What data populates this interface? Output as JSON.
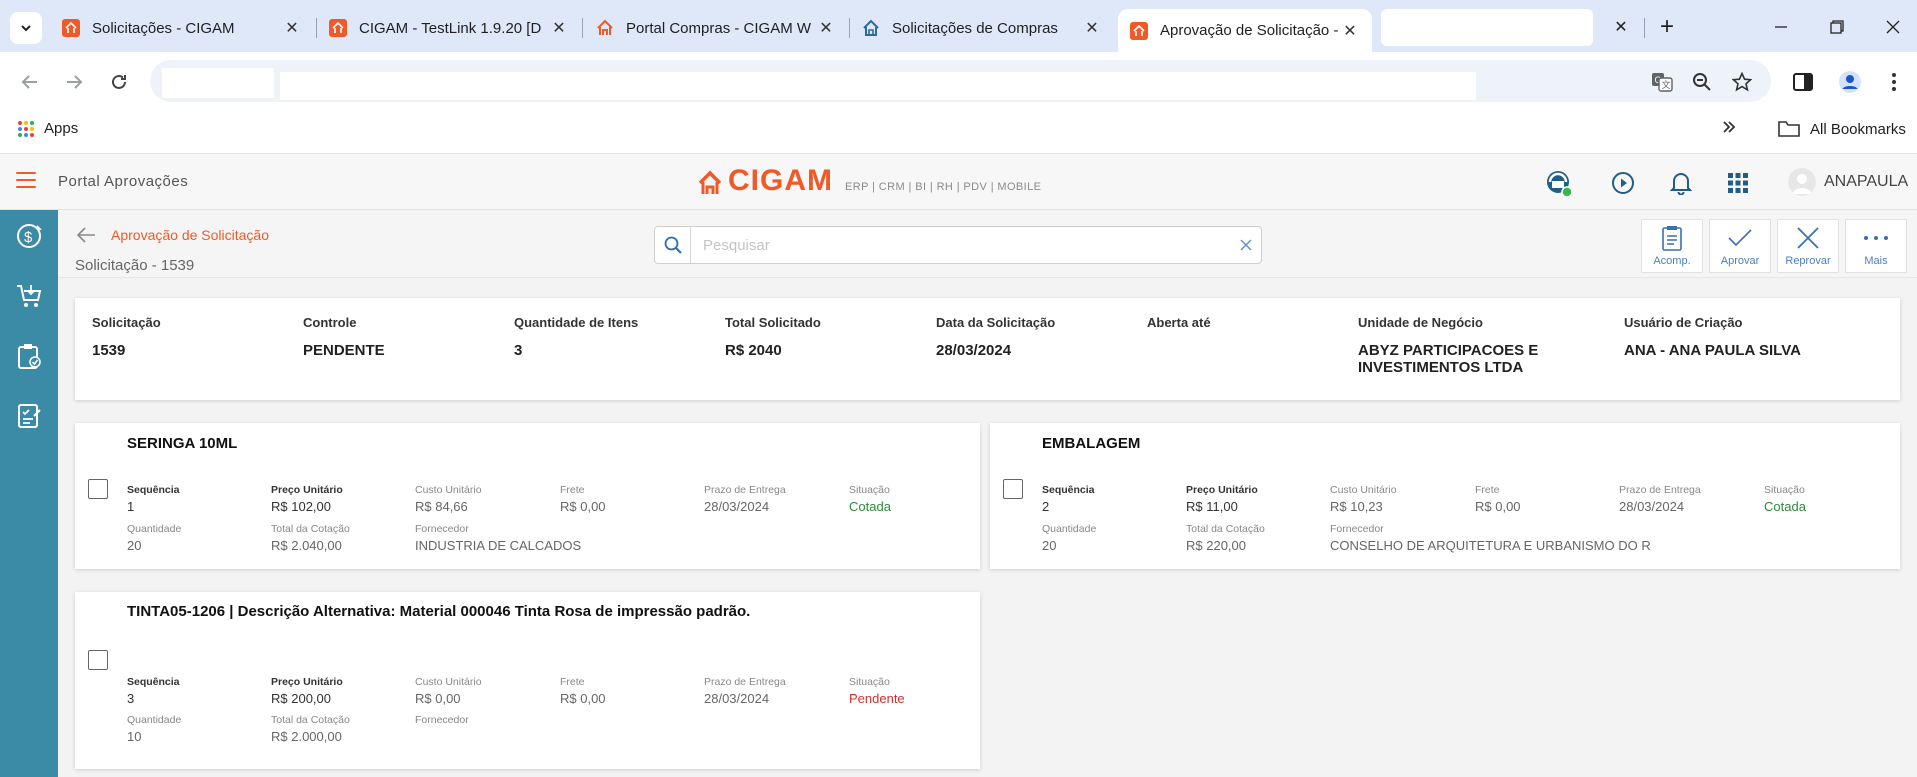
{
  "browser": {
    "tabs": [
      {
        "title": "Solicitações - CIGAM",
        "favicon": "cigam-icon",
        "active": false
      },
      {
        "title": "CIGAM - TestLink 1.9.20 [D",
        "favicon": "cigam-icon",
        "active": false
      },
      {
        "title": "Portal Compras - CIGAM W",
        "favicon": "cigam-house-icon",
        "active": false
      },
      {
        "title": "Solicitações de Compras",
        "favicon": "house-blue-icon",
        "active": false
      },
      {
        "title": "Aprovação de Solicitação -",
        "favicon": "cigam-icon",
        "active": true
      },
      {
        "title": "",
        "favicon": "",
        "active": false
      }
    ],
    "bookmarks": {
      "apps_label": "Apps",
      "all_bookmarks_label": "All Bookmarks"
    }
  },
  "app": {
    "portal_title": "Portal Aprovações",
    "logo_text": "CIGAM",
    "logo_subtitle": "ERP | CRM | BI | RH | PDV | MOBILE",
    "user_name": "ANAPAULA",
    "accent_color": "#f05a28",
    "rail_color": "#3b8aa6"
  },
  "page": {
    "breadcrumb": "Aprovação de Solicitação",
    "title": "Solicitação - 1539",
    "search_placeholder": "Pesquisar",
    "actions": [
      {
        "label": "Acomp.",
        "icon": "clipboard-icon"
      },
      {
        "label": "Aprovar",
        "icon": "check-icon"
      },
      {
        "label": "Reprovar",
        "icon": "close-icon"
      },
      {
        "label": "Mais",
        "icon": "more-icon"
      }
    ]
  },
  "summary": {
    "solicitacao": {
      "label": "Solicitação",
      "value": "1539"
    },
    "controle": {
      "label": "Controle",
      "value": "PENDENTE"
    },
    "quantidade_itens": {
      "label": "Quantidade de Itens",
      "value": "3"
    },
    "total": {
      "label": "Total Solicitado",
      "value": "R$ 2040"
    },
    "data": {
      "label": "Data da Solicitação",
      "value": "28/03/2024"
    },
    "aberta": {
      "label": "Aberta até",
      "value": ""
    },
    "unidade": {
      "label": "Unidade de Negócio",
      "value": "ABYZ PARTICIPACOES E INVESTIMENTOS LTDA"
    },
    "usuario": {
      "label": "Usuário de Criação",
      "value": "ANA - ANA PAULA SILVA"
    }
  },
  "labels": {
    "sequencia": "Sequência",
    "preco_unitario": "Preço Unitário",
    "custo_unitario": "Custo Unitário",
    "frete": "Frete",
    "prazo": "Prazo de Entrega",
    "situacao": "Situação",
    "quantidade": "Quantidade",
    "total_cotacao": "Total da Cotação",
    "fornecedor": "Fornecedor"
  },
  "items": [
    {
      "title": "SERINGA 10ML",
      "sequencia": "1",
      "preco_unitario": "R$ 102,00",
      "custo_unitario": "R$ 84,66",
      "frete": "R$ 0,00",
      "prazo": "28/03/2024",
      "situacao": "Cotada",
      "quantidade": "20",
      "total_cotacao": "R$ 2.040,00",
      "fornecedor": "INDUSTRIA DE CALCADOS"
    },
    {
      "title": "EMBALAGEM",
      "sequencia": "2",
      "preco_unitario": "R$ 11,00",
      "custo_unitario": "R$ 10,23",
      "frete": "R$ 0,00",
      "prazo": "28/03/2024",
      "situacao": "Cotada",
      "quantidade": "20",
      "total_cotacao": "R$ 220,00",
      "fornecedor": "CONSELHO DE ARQUITETURA E URBANISMO DO R"
    },
    {
      "title": "TINTA05-1206 | Descrição Alternativa: Material 000046 Tinta Rosa de impressão padrão.",
      "sequencia": "3",
      "preco_unitario": "R$ 200,00",
      "custo_unitario": "R$ 0,00",
      "frete": "R$ 0,00",
      "prazo": "28/03/2024",
      "situacao": "Pendente",
      "quantidade": "10",
      "total_cotacao": "R$ 2.000,00",
      "fornecedor": ""
    }
  ]
}
